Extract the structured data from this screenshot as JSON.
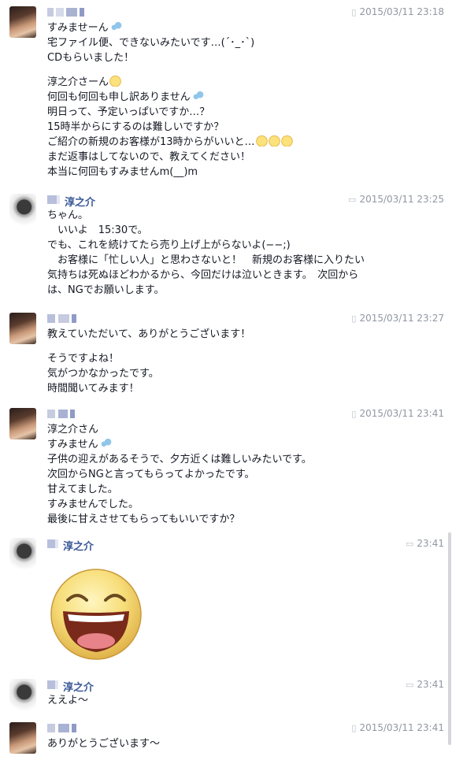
{
  "messages": [
    {
      "sender": "",
      "time": "2015/03/11 23:18",
      "lines": [
        "すみませーん[drop]",
        "宅ファイル便、できないみたいです…(´･_･`)",
        "CDもらいました！",
        "",
        "淳之介さーん[tear]",
        "何回も何回も申し訳ありません[drop]",
        "明日って、予定いっぱいですか…？",
        "15時半からにするのは難しいですか？",
        "ご紹介の新規のお客様が13時からがいいと…[tear][tear][tear]",
        "まだ返事はしてないので、教えてください！",
        "本当に何回もすみませんm(__)m"
      ]
    },
    {
      "sender": "淳之介",
      "time": "2015/03/11 23:25",
      "lines": [
        "ちゃん。",
        "　いいよ　15:30で。",
        "でも、これを続けてたら売り上げ上がらないよ(−−;)",
        "　お客様に「忙しい人」と思わさないと！　新規のお客様に入りたい",
        "気持ちは死ぬほどわかるから、今回だけは泣いときます。　次回から",
        "は、NGでお願いします。"
      ]
    },
    {
      "sender": "",
      "time": "2015/03/11 23:27",
      "lines": [
        "教えていただいて、ありがとうございます！",
        "",
        "そうですよね！",
        "気がつかなかったです。",
        "時間聞いてみます！"
      ]
    },
    {
      "sender": "",
      "time": "2015/03/11 23:41",
      "lines": [
        "淳之介さん",
        "すみません[drop]",
        "子供の迎えがあるそうで、夕方近くは難しいみたいです。",
        "次回からNGと言ってもらってよかったです。",
        "甘えてました。",
        "すみませんでした。",
        "最後に甘えさせてもらってもいいですか？"
      ]
    },
    {
      "sender": "淳之介",
      "time": "23:41",
      "lines": []
    },
    {
      "sender": "淳之介",
      "time": "23:41",
      "lines": [
        "ええよ〜"
      ]
    },
    {
      "sender": "",
      "time": "2015/03/11 23:41",
      "lines": [
        "ありがとうございます〜"
      ]
    }
  ],
  "icons": {
    "mobile": "mobile-phone-icon",
    "chat": "chat-bubble-icon",
    "tear": "crying-face-emoji",
    "drop": "sweat-drops-emoji",
    "sticker": "laughing-face-sticker"
  },
  "colors": {
    "sender": "#3b5998",
    "timestamp": "#9197a3",
    "text": "#141823"
  }
}
